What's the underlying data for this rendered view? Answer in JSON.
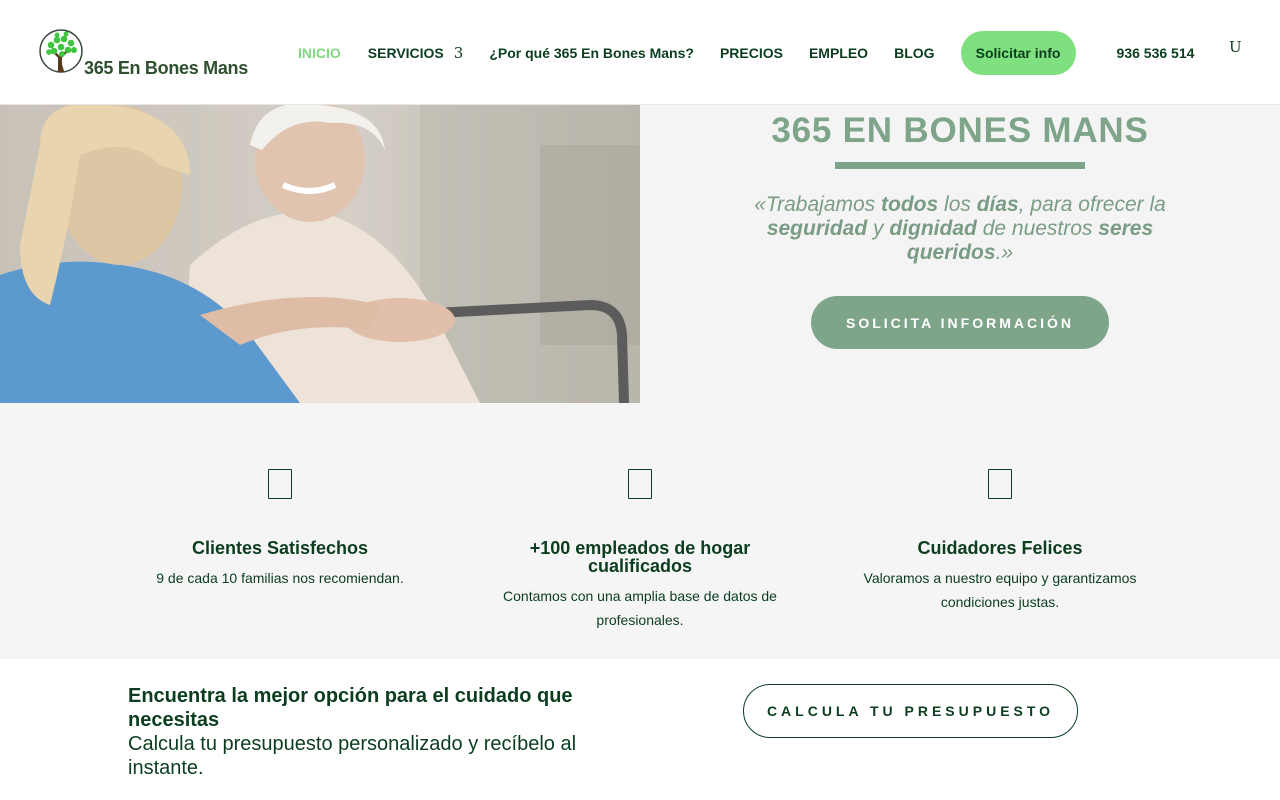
{
  "brand": {
    "name": "365 En Bones Mans",
    "logo_icon": "tree-icon"
  },
  "nav": {
    "items": [
      {
        "label": "INICIO",
        "active": true
      },
      {
        "label": "SERVICIOS",
        "arrow": "3"
      },
      {
        "label": "¿Por qué 365 En Bones Mans?"
      },
      {
        "label": "PRECIOS"
      },
      {
        "label": "EMPLEO"
      },
      {
        "label": "BLOG"
      }
    ],
    "cta_label": "Solicitar info",
    "phone": "936 536 514",
    "search_glyph": "U"
  },
  "hero": {
    "title": "365 EN BONES MANS",
    "quote_parts": {
      "p1": "«Trabajamos ",
      "b1": "todos",
      "p2": " los ",
      "b2": "días",
      "p3": ", para ofrecer la ",
      "b3": "seguridad",
      "p4": " y ",
      "b4": "dignidad",
      "p5": " de nuestros ",
      "b5": "seres queridos",
      "p6": ".»"
    },
    "button_label": "SOLICITA INFORMACIÓN",
    "image_description": "caregiver holding hands with elderly woman in wheelchair"
  },
  "features": [
    {
      "icon": "smile-icon",
      "title": "Clientes Satisfechos",
      "desc": "9 de cada 10 familias nos recomiendan."
    },
    {
      "icon": "people-icon",
      "title": "+100 empleados de hogar cualificados",
      "desc": "Contamos con una amplia base de datos de profesionales."
    },
    {
      "icon": "heart-icon",
      "title": "Cuidadores Felices",
      "desc": "Valoramos a nuestro equipo y garantizamos condiciones justas."
    }
  ],
  "cta_band": {
    "heading": "Encuentra la mejor opción para el cuidado que necesitas",
    "subheading": "Calcula tu presupuesto personalizado y recíbelo al instante.",
    "button_label": "CALCULA TU PRESUPUESTO"
  },
  "colors": {
    "primary_dark": "#0b3d1e",
    "accent_green": "#7ee07e",
    "sage": "#7ea58a",
    "background_light": "#f5f5f5"
  }
}
